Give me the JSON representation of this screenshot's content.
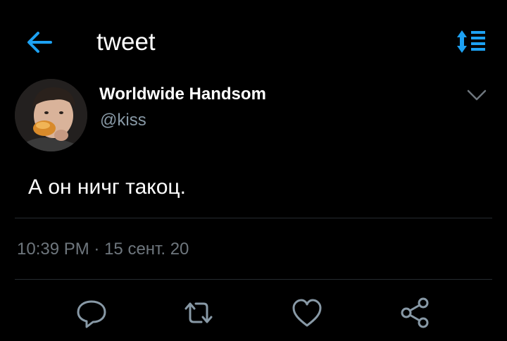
{
  "header": {
    "title": "tweet",
    "back_icon": "arrow-left-icon",
    "sort_icon": "sort-list-icon"
  },
  "tweet": {
    "author_name": "Worldwide Handsom",
    "author_handle": "@kiss",
    "text": "А он ничг такоц.",
    "time": "10:39 PM",
    "separator": "·",
    "date": "15 сент. 20"
  },
  "actions": [
    "reply-icon",
    "retweet-icon",
    "like-icon",
    "share-icon"
  ],
  "colors": {
    "background": "#000000",
    "accent": "#1da1f2",
    "muted": "#6e767d",
    "divider": "#262b30"
  }
}
